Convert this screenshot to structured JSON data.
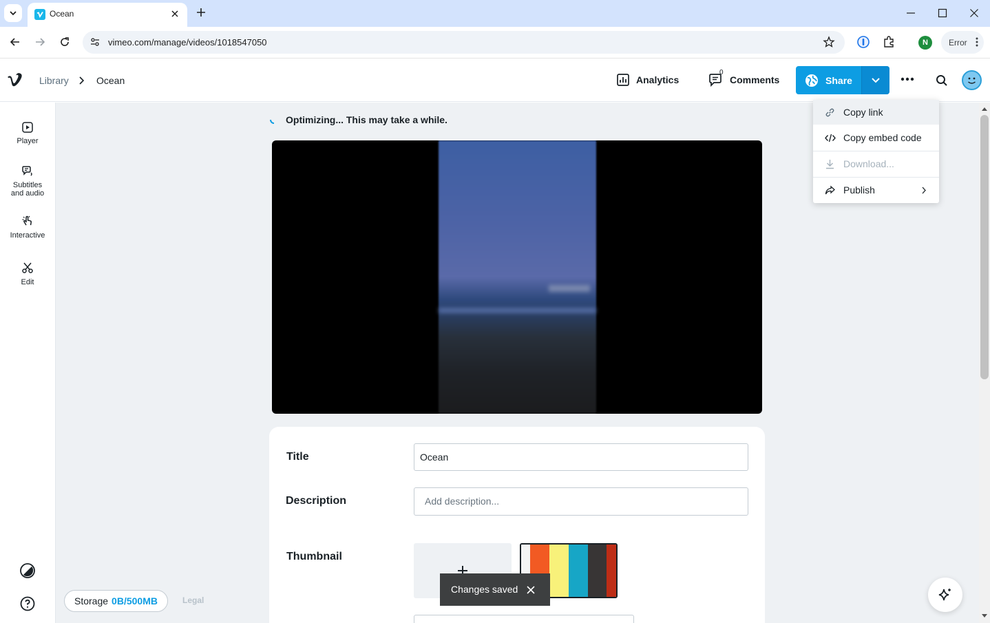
{
  "browser": {
    "tab_title": "Ocean",
    "url": "vimeo.com/manage/videos/1018547050",
    "profile_initial": "N",
    "error_label": "Error"
  },
  "header": {
    "breadcrumb_library": "Library",
    "breadcrumb_current": "Ocean",
    "analytics_label": "Analytics",
    "comments_label": "Comments",
    "comments_count": "0",
    "share_label": "Share"
  },
  "sidebar": {
    "items": [
      {
        "label": "Player",
        "icon": "play-square-icon"
      },
      {
        "label": "Subtitles and audio",
        "icon": "subtitles-audio-icon"
      },
      {
        "label": "Interactive",
        "icon": "pointer-tap-icon"
      },
      {
        "label": "Edit",
        "icon": "scissors-icon"
      }
    ]
  },
  "main": {
    "status_text": "Optimizing... This may take a while.",
    "form": {
      "title_label": "Title",
      "title_value": "Ocean",
      "description_label": "Description",
      "description_placeholder": "Add description...",
      "thumbnail_label": "Thumbnail"
    },
    "thumbnail_colors": [
      "#f4f4f4",
      "#f25a23",
      "#f8f17a",
      "#17a6c6",
      "#383535",
      "#bd2d16"
    ]
  },
  "toast": {
    "message": "Changes saved"
  },
  "footer": {
    "storage_label": "Storage",
    "storage_value": "0B/500MB",
    "legal_label": "Legal"
  },
  "share_menu": {
    "items": [
      {
        "label": "Copy link",
        "icon": "link-icon",
        "state": "highlighted"
      },
      {
        "label": "Copy embed code",
        "icon": "code-icon",
        "state": "normal"
      },
      {
        "label": "Download...",
        "icon": "download-icon",
        "state": "disabled"
      },
      {
        "label": "Publish",
        "icon": "share-arrow-icon",
        "state": "normal",
        "has_submenu": true
      }
    ]
  },
  "colors": {
    "accent": "#0d9de3",
    "toast_bg": "#3d3f40",
    "page_bg": "#eef1f4"
  }
}
